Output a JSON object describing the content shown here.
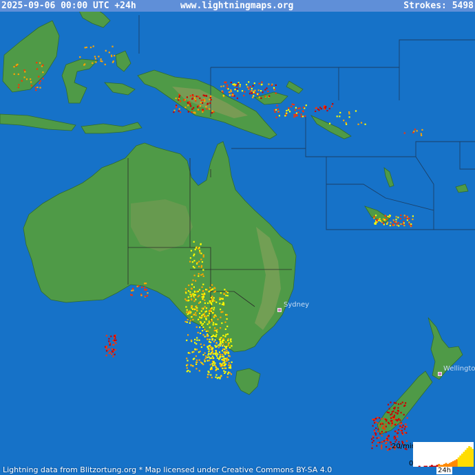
{
  "header": {
    "timestamp": "2025-09-06 00:00 UTC +24h",
    "site": "www.lightningmaps.org",
    "strokes_label": "Strokes: 5498"
  },
  "footer": {
    "credit": "Lightning data from Blitzortung.org  *  Map licensed under Creative Commons BY-SA 4.0"
  },
  "cities": [
    {
      "name": "Sydney"
    },
    {
      "name": "Wellington"
    }
  ],
  "histogram": {
    "rate_label": "20/min",
    "zero_label": "0",
    "span_label": "24h",
    "bars": [
      0,
      0,
      0,
      1,
      0,
      0,
      1,
      1,
      0,
      1,
      2,
      1,
      1,
      2,
      3,
      2,
      2,
      3,
      4,
      3,
      4,
      5,
      6,
      7,
      8,
      10,
      12,
      14,
      16,
      18,
      20,
      22,
      21,
      19
    ]
  },
  "colors": {
    "ocean": "#1672c8",
    "land": "#4f9a47",
    "land_dark": "#3f8a3c",
    "highland": "#8a9b5a",
    "border": "#2a2a2a",
    "recent": "#ffff00",
    "mid": "#ffa500",
    "old": "#ff3300",
    "oldest": "#cc0000"
  }
}
